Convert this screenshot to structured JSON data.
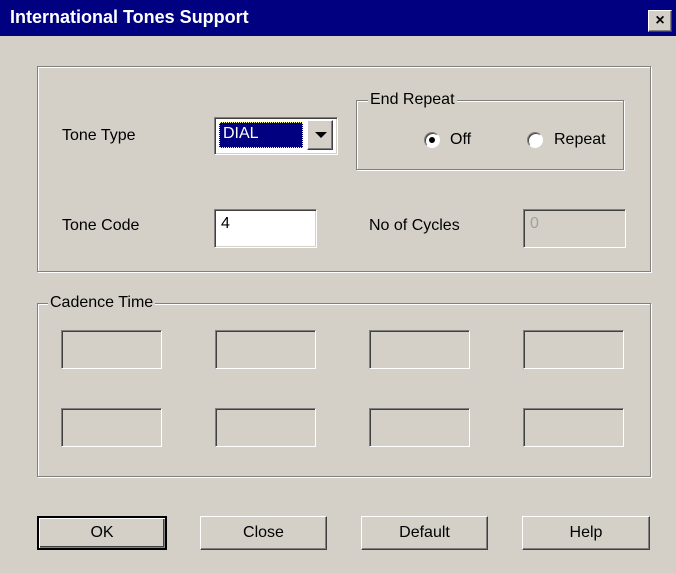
{
  "window": {
    "title": "International Tones Support",
    "close_glyph": "×"
  },
  "settings": {
    "tone_type_label": "Tone Type",
    "tone_type_value": "DIAL",
    "tone_code_label": "Tone Code",
    "tone_code_value": "4",
    "end_repeat": {
      "legend": "End Repeat",
      "options": [
        "Off",
        "Repeat"
      ],
      "selected": "Off"
    },
    "cycles_label": "No of Cycles",
    "cycles_value": "0"
  },
  "cadence": {
    "legend": "Cadence Time",
    "fields": [
      "",
      "",
      "",
      "",
      "",
      "",
      "",
      ""
    ]
  },
  "buttons": {
    "ok": "OK",
    "close": "Close",
    "default": "Default",
    "help": "Help"
  },
  "colors": {
    "title_bar": "#000080",
    "face": "#d4d0c8",
    "selection": "#000080"
  },
  "icons": {
    "close": "close-icon",
    "dropdown": "chevron-down-icon"
  }
}
